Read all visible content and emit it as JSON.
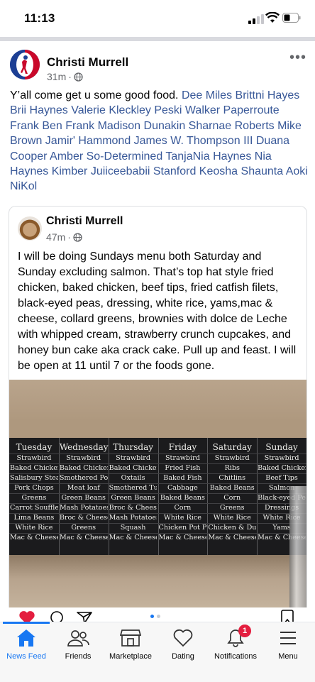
{
  "status_bar": {
    "time": "11:13"
  },
  "post": {
    "author": "Christi Murrell",
    "time": "31m",
    "caption_text": "Y’all come get u some good food.",
    "caption_tags": "Dee Miles Brittni Hayes Brii Haynes Valerie Kleckley Peski Walker Paperroute Frank Ben Frank Madison Dunakin Sharnae Roberts Mike Brown Jamir' Hammond James W. Thompson III Duana Cooper Amber So-Determined TanjaNia Haynes Nia Haynes Kimber Juiiceebabii Stanford Keosha Shaunta Aoki NiKol",
    "more_label": "•••"
  },
  "shared_post": {
    "author": "Christi Murrell",
    "time": "47m",
    "text": "I will be doing Sundays menu both Saturday and Sunday excluding salmon. That’s top hat style fried chicken, baked chicken, beef tips, fried catfish filets, black-eyed peas, dressing, white rice, yams,mac & cheese, collard greens, brownies with dolce de Leche with whipped cream, strawberry crunch cupcakes, and honey bun cake aka crack cake. Pull up and feast. I will be open at 11 until 7 or the foods gone."
  },
  "menu_board": [
    {
      "day": "Tuesday",
      "items": [
        "Strawbird",
        "Baked Chicken",
        "Salisbury Steak",
        "Pork Chops",
        "Greens",
        "Carrot Souffle",
        "Lima Beans",
        "White Rice",
        "Mac & Cheese"
      ]
    },
    {
      "day": "Wednesday",
      "items": [
        "Strawbird",
        "Baked Chicken",
        "Smothered Pork Chops",
        "Meat loaf",
        "Green Beans",
        "Mash Potatoes",
        "Broc & Cheese Casserole",
        "Greens",
        "Mac & Cheese"
      ]
    },
    {
      "day": "Thursday",
      "items": [
        "Strawbird",
        "Baked Chicken",
        "Oxtails",
        "Smothered Turkey Wings",
        "Green Beans",
        "Broc & Cheese",
        "Mash Potatoes",
        "Squash",
        "Mac & Cheese"
      ]
    },
    {
      "day": "Friday",
      "items": [
        "Strawbird",
        "Fried Fish",
        "Baked Fish",
        "Cabbage",
        "Baked Beans",
        "Corn",
        "White Rice",
        "Chicken Pot Pie",
        "Mac & Cheese"
      ]
    },
    {
      "day": "Saturday",
      "items": [
        "Strawbird",
        "Ribs",
        "Chitlins",
        "Baked Beans",
        "Corn",
        "Greens",
        "White Rice",
        "Chicken & Dumplings",
        "Mac & Cheese"
      ]
    },
    {
      "day": "Sunday",
      "items": [
        "Strawbird",
        "Baked Chicken",
        "Beef Tips",
        "Salmon",
        "Black-eyed Peas",
        "Dressings",
        "White Rice",
        "Yams",
        "Mac & Cheese"
      ]
    }
  ],
  "tabs": [
    {
      "label": "News Feed",
      "icon": "home-icon"
    },
    {
      "label": "Friends",
      "icon": "friends-icon"
    },
    {
      "label": "Marketplace",
      "icon": "marketplace-icon"
    },
    {
      "label": "Dating",
      "icon": "dating-icon"
    },
    {
      "label": "Notifications",
      "icon": "bell-icon",
      "badge": "1"
    },
    {
      "label": "Menu",
      "icon": "menu-icon"
    }
  ],
  "colors": {
    "link": "#385898",
    "accent": "#1877f2",
    "badge": "#e41e3f",
    "like_heart": "#e41e3f"
  }
}
